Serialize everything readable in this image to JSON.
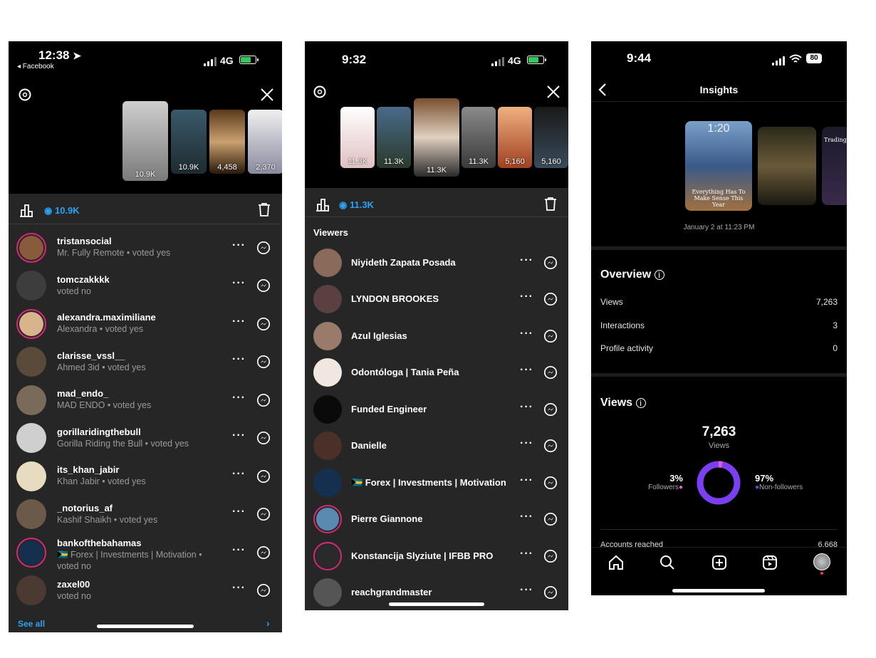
{
  "panel1": {
    "time": "12:38",
    "back_app": "◂ Facebook",
    "network": "4G",
    "thumb_counts": [
      "10.9K",
      "10.9K",
      "4,458",
      "2,370"
    ],
    "view_count": "10.9K",
    "viewers": [
      {
        "name": "tristansocial",
        "sub": "Mr. Fully Remote • voted yes",
        "ring": true,
        "bg": "#8a5a3c"
      },
      {
        "name": "tomczakkkk",
        "sub": "voted no",
        "ring": false,
        "bg": "#3d3d3d"
      },
      {
        "name": "alexandra.maximiliane",
        "sub": "Alexandra • voted yes",
        "ring": true,
        "bg": "#d8b48c"
      },
      {
        "name": "clarisse_vssl__",
        "sub": "Ahmed 3id • voted yes",
        "ring": false,
        "bg": "#5a4a3a"
      },
      {
        "name": "mad_endo_",
        "sub": "MAD ENDO • voted yes",
        "ring": false,
        "bg": "#7a6a5a"
      },
      {
        "name": "gorillaridingthebull",
        "sub": "Gorilla Riding the Bull • voted yes",
        "ring": false,
        "bg": "#cfcfcf"
      },
      {
        "name": "its_khan_jabir",
        "sub": "Khan Jabir • voted yes",
        "ring": false,
        "bg": "#e8dcc0"
      },
      {
        "name": "_notorius_af",
        "sub": "Kashif Shaikh • voted yes",
        "ring": false,
        "bg": "#6b5a4a"
      },
      {
        "name": "bankofthebahamas",
        "sub": "🇧🇸 Forex | Investments | Motivation •",
        "sub2": "voted no",
        "ring": true,
        "bg": "#14304e"
      },
      {
        "name": "zaxel00",
        "sub": "voted no",
        "ring": false,
        "bg": "#4a3a32"
      }
    ],
    "see_all": "See all"
  },
  "panel2": {
    "time": "9:32",
    "network": "4G",
    "thumb_counts": [
      "11.3K",
      "11.3K",
      "11.3K",
      "11.3K",
      "5,160",
      "5,160"
    ],
    "view_count": "11.3K",
    "viewers_heading": "Viewers",
    "viewers": [
      {
        "name": "Niyideth Zapata Posada",
        "ring": false,
        "bg": "#8a6a5a"
      },
      {
        "name": "LYNDON BROOKES",
        "ring": false,
        "bg": "#5a4040"
      },
      {
        "name": "Azul Iglesias",
        "ring": false,
        "bg": "#9a7a6a"
      },
      {
        "name": "Odontóloga | Tania Peña",
        "ring": false,
        "bg": "#f0e8e0"
      },
      {
        "name": "Funded Engineer",
        "ring": false,
        "bg": "#0a0a0a"
      },
      {
        "name": "Danielle",
        "ring": false,
        "bg": "#4a3028"
      },
      {
        "name": "🇧🇸 Forex | Investments | Motivation",
        "ring": false,
        "bg": "#14304e"
      },
      {
        "name": "Pierre Giannone",
        "ring": true,
        "bg": "#5a8ab0"
      },
      {
        "name": "Konstancija Slyziute | IFBB PRO",
        "ring": true,
        "bg": "#2a2a2a"
      },
      {
        "name": "reachgrandmaster",
        "ring": false,
        "bg": "#555555"
      }
    ]
  },
  "panel3": {
    "time": "9:44",
    "battery": "80",
    "title": "Insights",
    "story_card_top": "1:20",
    "story_card_text": "Everything Has To Make Sense This Year",
    "story_card_right_text": "Trading B",
    "date": "January 2 at 11:23 PM",
    "overview_title": "Overview",
    "overview": [
      {
        "label": "Views",
        "value": "7,263"
      },
      {
        "label": "Interactions",
        "value": "3"
      },
      {
        "label": "Profile activity",
        "value": "0"
      }
    ],
    "views_title": "Views",
    "views_total": "7,263",
    "views_caption": "Views",
    "followers_pct": "3%",
    "followers_label": "Followers",
    "nonfollowers_pct": "97%",
    "nonfollowers_label": "Non-followers",
    "donut": {
      "followers_fraction": 0.03,
      "followers_color": "#e65bd4",
      "nonfollowers_color": "#7b3ff2"
    },
    "accounts_reached_label": "Accounts reached",
    "accounts_reached_value": "6,668"
  }
}
